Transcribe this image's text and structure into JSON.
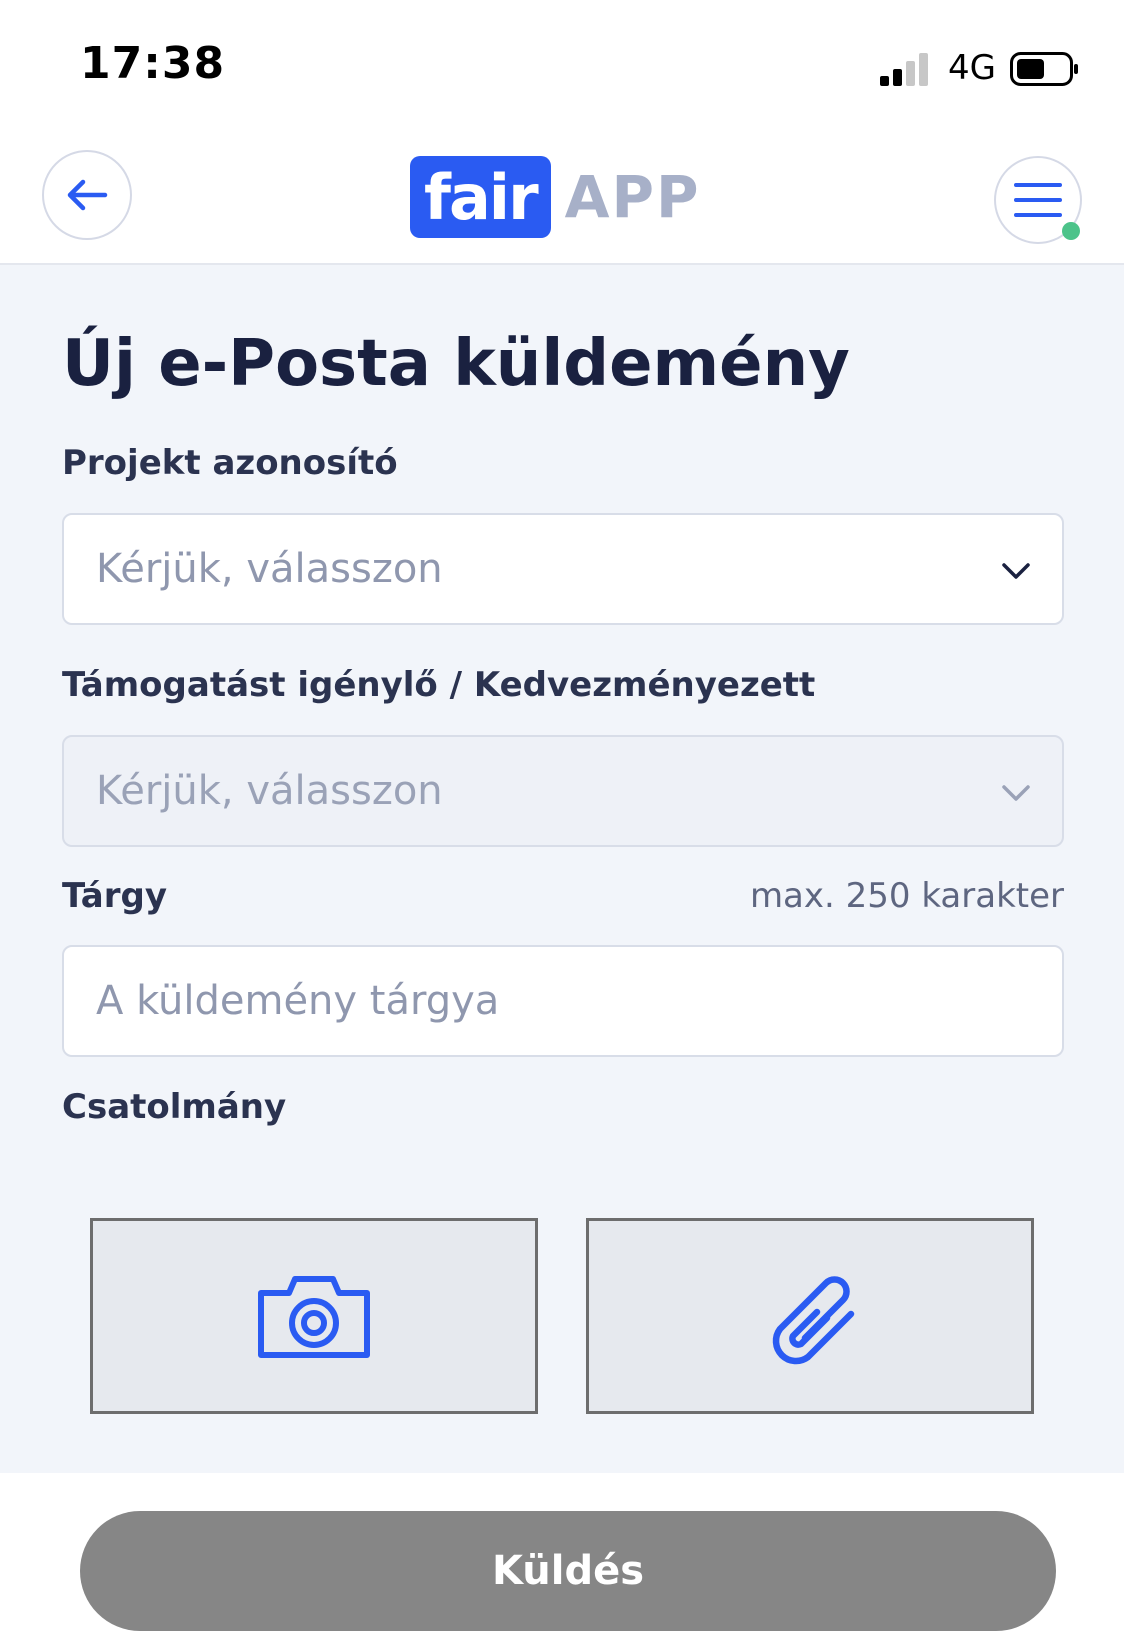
{
  "status_bar": {
    "time": "17:38",
    "network": "4G"
  },
  "header": {
    "logo_primary": "fair",
    "logo_secondary": "APP",
    "accent_color": "#2a5bf2"
  },
  "form": {
    "title": "Új e-Posta küldemény",
    "project": {
      "label": "Projekt azonosító",
      "placeholder": "Kérjük, válasszon"
    },
    "beneficiary": {
      "label": "Támogatást igénylő / Kedvezményezett",
      "placeholder": "Kérjük, válasszon",
      "disabled": true
    },
    "subject": {
      "label": "Tárgy",
      "hint": "max. 250 karakter",
      "placeholder": "A küldemény tárgya"
    },
    "attachment": {
      "label": "Csatolmány",
      "icons": [
        "camera-icon",
        "paperclip-icon"
      ]
    }
  },
  "footer": {
    "send_label": "Küldés",
    "button_color": "#868686"
  }
}
